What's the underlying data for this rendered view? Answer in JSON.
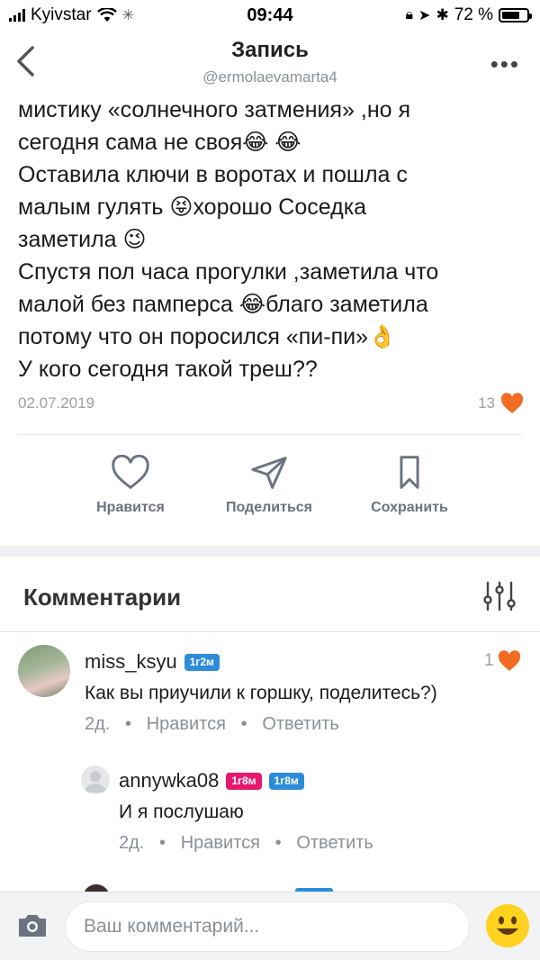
{
  "status_bar": {
    "carrier": "Kyivstar",
    "time": "09:44",
    "battery": "72 %"
  },
  "header": {
    "title": "Запись",
    "subtitle": "@ermolaevamarta4"
  },
  "post": {
    "lines": [
      "мистику «солнечного затмения» ,но я",
      "сегодня сама не своя😂 😂",
      "Оставила ключи в воротах и пошла с",
      "малым гулять 😝хорошо Соседка",
      "заметила 😉",
      "Спустя пол часа прогулки ,заметила что",
      "малой без памперса 😂благо заметила",
      "потому что он поросился «пи-пи»👌",
      "У кого сегодня такой треш??"
    ],
    "date": "02.07.2019",
    "likes": "13"
  },
  "actions": {
    "like_label": "Нравится",
    "share_label": "Поделиться",
    "save_label": "Сохранить"
  },
  "comments_section": {
    "title": "Комментарии",
    "comments": [
      {
        "username": "miss_ksyu",
        "badge": "1г2м",
        "text": "Как вы приучили к горшку, поделитесь?)",
        "age": "2д.",
        "like_action": "Нравится",
        "reply_action": "Ответить",
        "likes": "1"
      },
      {
        "username": "annywka08",
        "badges": [
          "1г8м",
          "1г8м"
        ],
        "text": "И я послушаю",
        "age": "2д.",
        "like_action": "Нравится",
        "reply_action": "Ответить"
      }
    ]
  },
  "composer": {
    "placeholder": "Ваш комментарий..."
  },
  "colors": {
    "accent_orange": "#f26b22",
    "badge_blue": "#2d8cd8",
    "badge_pink": "#e8176e"
  }
}
